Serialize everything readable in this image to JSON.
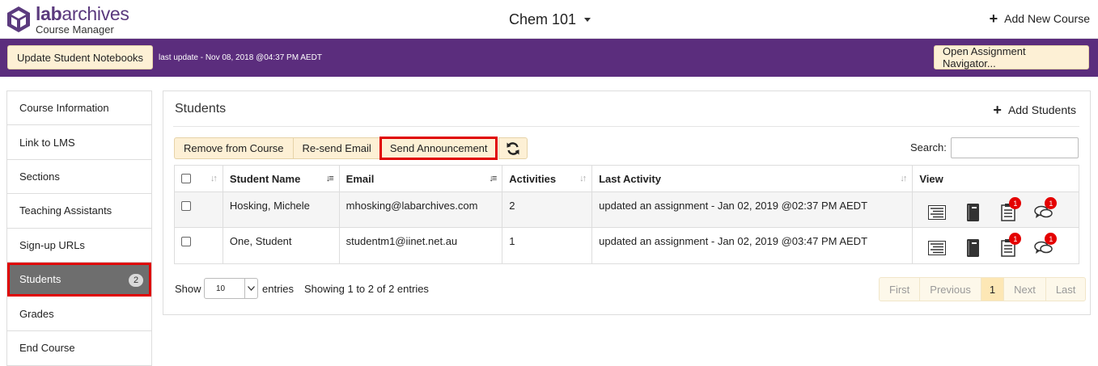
{
  "header": {
    "brand_prefix": "lab",
    "brand_suffix": "archives",
    "subtitle": "Course Manager",
    "course_title": "Chem 101",
    "add_course_label": "Add New Course"
  },
  "toolbar": {
    "update_label": "Update Student Notebooks",
    "last_update": "last update - Nov 08, 2018 @04:37 PM AEDT",
    "navigator_label": "Open Assignment Navigator..."
  },
  "sidebar": {
    "items": [
      {
        "label": "Course Information"
      },
      {
        "label": "Link to LMS"
      },
      {
        "label": "Sections"
      },
      {
        "label": "Teaching Assistants"
      },
      {
        "label": "Sign-up URLs"
      },
      {
        "label": "Students",
        "badge": "2",
        "active": true
      },
      {
        "label": "Grades"
      },
      {
        "label": "End Course"
      }
    ]
  },
  "panel": {
    "title": "Students",
    "add_students_label": "Add Students",
    "actions": {
      "remove": "Remove from Course",
      "resend": "Re-send Email",
      "announce": "Send Announcement"
    },
    "search_label": "Search:",
    "search_value": ""
  },
  "table": {
    "columns": [
      "Student Name",
      "Email",
      "Activities",
      "Last Activity",
      "View"
    ],
    "rows": [
      {
        "name": "Hosking, Michele",
        "email": "mhosking@labarchives.com",
        "activities": "2",
        "last_activity": "updated an assignment - Jan 02, 2019 @02:37 PM AEDT",
        "notes_badge": "1",
        "comments_badge": "1"
      },
      {
        "name": "One, Student",
        "email": "studentm1@iinet.net.au",
        "activities": "1",
        "last_activity": "updated an assignment - Jan 02, 2019 @03:47 PM AEDT",
        "notes_badge": "1",
        "comments_badge": "1"
      }
    ]
  },
  "footer": {
    "show_label": "Show",
    "page_size": "10",
    "entries_label": "entries",
    "showing_text": "Showing 1 to 2 of 2 entries",
    "pager": {
      "first": "First",
      "previous": "Previous",
      "current": "1",
      "next": "Next",
      "last": "Last"
    }
  },
  "colors": {
    "brand_purple": "#5b2d7d",
    "highlight_red": "#e00000",
    "button_cream": "#fdf0d5"
  }
}
